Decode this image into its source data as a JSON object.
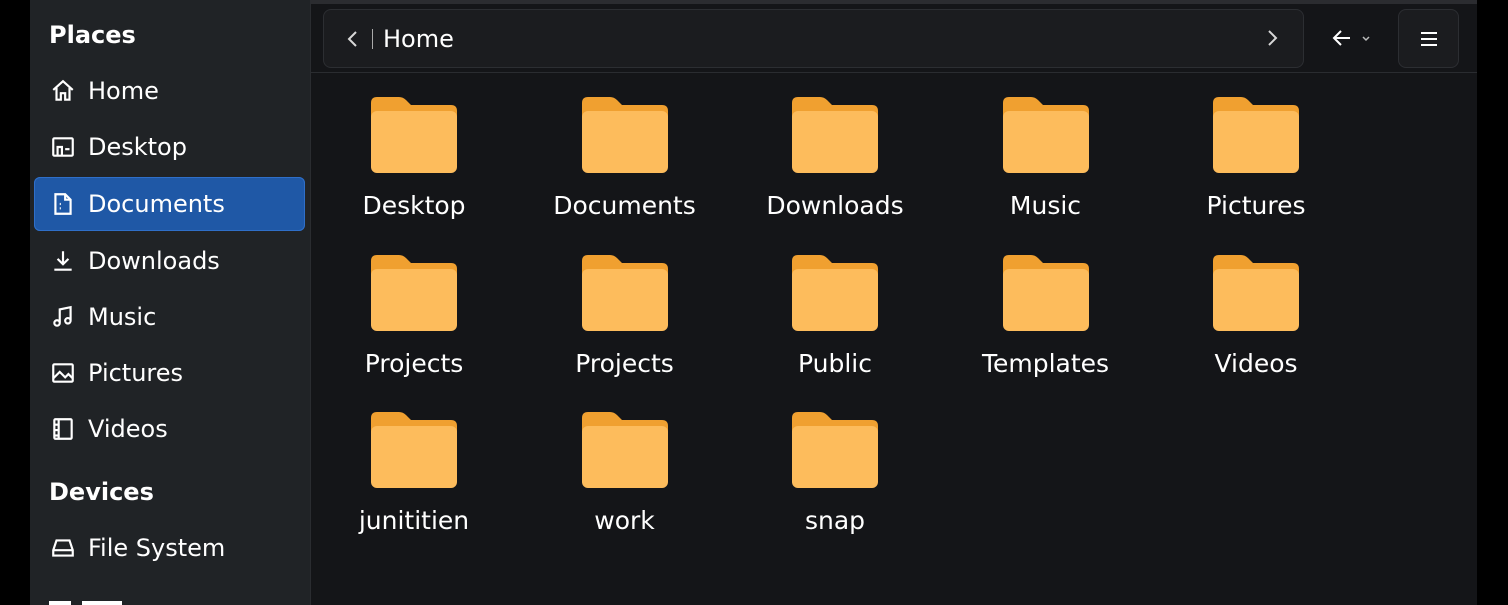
{
  "sidebar": {
    "places_heading": "Places",
    "places": [
      {
        "label": "Home",
        "icon": "home-icon"
      },
      {
        "label": "Desktop",
        "icon": "desktop-icon"
      },
      {
        "label": "Documents",
        "icon": "document-icon",
        "active": true
      },
      {
        "label": "Downloads",
        "icon": "download-icon"
      },
      {
        "label": "Music",
        "icon": "music-icon"
      },
      {
        "label": "Pictures",
        "icon": "picture-icon"
      },
      {
        "label": "Videos",
        "icon": "video-icon"
      }
    ],
    "devices_heading": "Devices",
    "devices": [
      {
        "label": "File System",
        "icon": "drive-icon"
      }
    ]
  },
  "header": {
    "path_label": "Home"
  },
  "folders": [
    "Desktop",
    "Documents",
    "Downloads",
    "Music",
    "Pictures",
    "Projects",
    "Projects",
    "Public",
    "Templates",
    "Videos",
    "junititien",
    "work",
    "snap"
  ],
  "colors": {
    "accent": "#1f58a6",
    "folder_body": "#fdbc5c",
    "folder_tab": "#f0a030"
  }
}
